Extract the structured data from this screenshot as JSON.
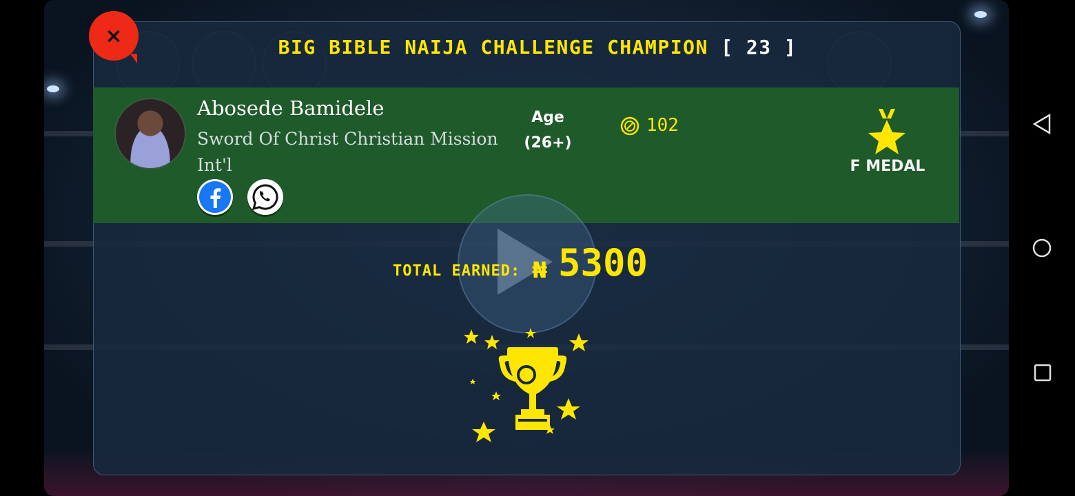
{
  "dialog": {
    "title": "Big Bible Naija Challenge Champion",
    "count": "[ 23 ]",
    "close_label": "×"
  },
  "player": {
    "name": "Abosede Bamidele",
    "organization": "Sword Of Christ Christian Mission Int'l",
    "age_label": "Age",
    "age_value": "(26+)",
    "coins": "102",
    "medal": "F MEDAL"
  },
  "earnings": {
    "label": "Total Earned:",
    "currency": "₦",
    "value": "5300"
  },
  "colors": {
    "accent": "#ffe600",
    "band": "#1f5a2b",
    "close": "#ee2a16"
  },
  "icons": [
    "close-icon",
    "facebook-icon",
    "whatsapp-icon",
    "coin-icon",
    "medal-icon",
    "trophy-icon",
    "back-icon",
    "home-icon",
    "recents-icon"
  ]
}
